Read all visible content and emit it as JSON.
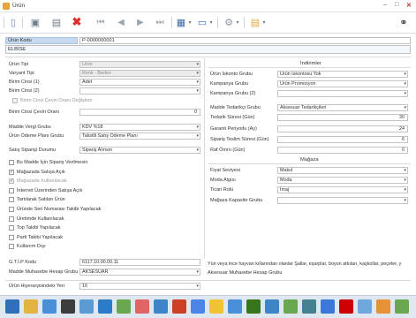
{
  "window": {
    "title": "Ürün",
    "minimize": "–",
    "maximize": "□",
    "close": "✕"
  },
  "toolbar": {
    "icons": [
      "new-icon",
      "save-icon",
      "save-as-icon",
      "delete-icon",
      "first-icon",
      "prev-icon",
      "next-icon",
      "last-icon",
      "print-icon",
      "preview-icon",
      "settings-icon",
      "menu-icon",
      "search-icon"
    ],
    "glyphs": {
      "new": "▯",
      "save": "▣",
      "saveas": "▤",
      "delete": "✖",
      "first": "⏮",
      "prev": "◀",
      "next": "▶",
      "last": "⏭",
      "print": "▦",
      "preview": "▭",
      "settings": "⚙",
      "menu": "▤",
      "dd": "▾",
      "binoc": "⚭"
    }
  },
  "header": {
    "code_label": "Ürün Kodu",
    "code_value": "P-0000000001",
    "name_value": "ELBİSE"
  },
  "left": {
    "urun_tipi": {
      "label": "Ürün Tipi",
      "value": "Ürün"
    },
    "varyant_tipi": {
      "label": "Varyant Tipi",
      "value": "Renk - Beden"
    },
    "birim1": {
      "label": "Birim Cinsi (1)",
      "value": "Adet"
    },
    "birim2": {
      "label": "Birim Cinsi (2)",
      "value": ""
    },
    "birim_oran_degisken": "Birim Cinsi Çeviri Oranı Değişken",
    "birim_oran": {
      "label": "Birim Cinsi Çeviri Oranı",
      "value": "0"
    },
    "vergi": {
      "label": "Madde Vergi Grubu",
      "value": "KDV %18"
    },
    "odeme": {
      "label": "Ürün Ödeme Planı Grubu",
      "value": "Taksitli Satış Ödeme Planı"
    },
    "satis_durumu": {
      "label": "Satış Siparişi Durumu",
      "value": "Sipariş Alınsın"
    },
    "checks": [
      {
        "label": "Bu Madde İçin Sipariş Verilmesin",
        "checked": false,
        "disabled": false
      },
      {
        "label": "Mağazada Satışa Açık",
        "checked": true,
        "disabled": false
      },
      {
        "label": "Mağazada Kullanılacak",
        "checked": true,
        "disabled": true
      },
      {
        "label": "İnternet Üzerinden Satışa Açık",
        "checked": false,
        "disabled": false
      },
      {
        "label": "Tartılarak Satılan Ürün",
        "checked": false,
        "disabled": false
      },
      {
        "label": "Üründe Seri Numarası Takibi Yapılacak",
        "checked": false,
        "disabled": false
      },
      {
        "label": "Üretimde Kullanılacak",
        "checked": false,
        "disabled": false
      },
      {
        "label": "Top Takibi Yapılacak",
        "checked": false,
        "disabled": false
      },
      {
        "label": "Parti Takibi Yapılacak",
        "checked": false,
        "disabled": false
      },
      {
        "label": "Kullanım Dışı",
        "checked": false,
        "disabled": false
      }
    ],
    "gtip": {
      "label": "G.T.İ.P Kodu",
      "value": "6117.10.00.00.11"
    },
    "muhasebe": {
      "label": "Madde Muhasebe Hesap Grubu",
      "value": "AKSESUAR"
    },
    "hiyerarsi": {
      "label": "Ürün Hiyerarşisindeki Yeri",
      "value": "16"
    }
  },
  "right": {
    "indirimler_title": "İndirimler",
    "iskonto": {
      "label": "Ürün İskonto Grubu",
      "value": "Ürün İskontosu Yok"
    },
    "kampanya": {
      "label": "Kampanya Grubu",
      "value": "Ürün Promosyon"
    },
    "kampanya2": {
      "label": "Kampanya Grubu (2)",
      "value": ""
    },
    "tedarikci": {
      "label": "Madde Tedarikçi Grubu",
      "value": "Aksesuar Tedarikçileri"
    },
    "tedarik_suresi": {
      "label": "Tedarik Süresi (Gün)",
      "value": "30"
    },
    "garanti": {
      "label": "Garanti Periyodu (Ay)",
      "value": "24"
    },
    "teslim": {
      "label": "Sipariş Teslim Süresi (Gün)",
      "value": "6"
    },
    "raf": {
      "label": "Raf Ömrü (Gün)",
      "value": "0"
    },
    "magaza_title": "Mağaza",
    "fiyat": {
      "label": "Fiyat Seviyesi",
      "value": "Makul"
    },
    "moda": {
      "label": "Moda Algısı",
      "value": "Moda"
    },
    "ticari": {
      "label": "Ticari Rolü",
      "value": "İmaj"
    },
    "kapasite": {
      "label": "Mağaza Kapasite Grubu",
      "value": ""
    },
    "description": "Yün veya ince hayvan kıllarından olanlar Şallar, eşarplar, boyun atkıları, kaşkollar, peçeler, y",
    "muhasebe_grubu": "Aksesuar Muhasebe Hesap Grubu"
  },
  "colors": {
    "label_bg": "#c7d9ee",
    "accent": "#3e6aa3",
    "delete": "#d93030",
    "taskbar": "#dfe7f1"
  },
  "taskbar": {
    "apps": [
      {
        "icon": "start-icon",
        "color": "#2f6fb7"
      },
      {
        "icon": "explorer-icon",
        "color": "#e3b341"
      },
      {
        "icon": "browser-icon",
        "color": "#4a90d9"
      },
      {
        "icon": "media-icon",
        "color": "#3c3c3c"
      },
      {
        "icon": "window-icon",
        "color": "#5b9bd5"
      },
      {
        "icon": "list-icon",
        "color": "#2d7bc6"
      },
      {
        "icon": "grid-icon",
        "color": "#6aa84f"
      },
      {
        "icon": "chart-icon",
        "color": "#e06666"
      },
      {
        "icon": "people-icon",
        "color": "#3d85c6"
      },
      {
        "icon": "document-icon",
        "color": "#cc4125"
      },
      {
        "icon": "print-icon",
        "color": "#4a86e8"
      },
      {
        "icon": "folder-icon",
        "color": "#f1c232"
      },
      {
        "icon": "chat-icon",
        "color": "#4a90d9"
      },
      {
        "icon": "bars-icon",
        "color": "#38761d"
      },
      {
        "icon": "settings-icon",
        "color": "#3d85c6"
      },
      {
        "icon": "tree-icon",
        "color": "#6aa84f"
      },
      {
        "icon": "globe-icon",
        "color": "#45818e"
      },
      {
        "icon": "clock-icon",
        "color": "#3c78d8"
      },
      {
        "icon": "mail-icon",
        "color": "#cc0000"
      },
      {
        "icon": "cloud-icon",
        "color": "#6fa8dc"
      },
      {
        "icon": "target-icon",
        "color": "#e69138"
      },
      {
        "icon": "check-icon",
        "color": "#6aa84f"
      }
    ]
  }
}
